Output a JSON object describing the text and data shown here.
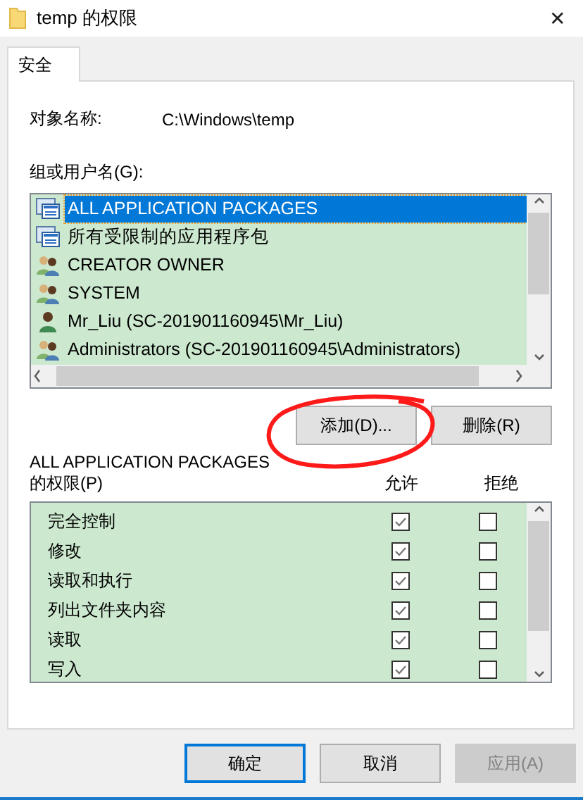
{
  "window": {
    "title": "temp 的权限",
    "close": "✕"
  },
  "tabs": [
    {
      "label": "安全",
      "selected": true
    }
  ],
  "object_name": {
    "label": "对象名称:",
    "value": "C:\\Windows\\temp"
  },
  "groups": {
    "label": "组或用户名(G):",
    "items": [
      {
        "name": "ALL APPLICATION PACKAGES",
        "kind": "package",
        "selected": true
      },
      {
        "name": "所有受限制的应用程序包",
        "kind": "package",
        "selected": false
      },
      {
        "name": "CREATOR OWNER",
        "kind": "group",
        "selected": false
      },
      {
        "name": "SYSTEM",
        "kind": "group",
        "selected": false
      },
      {
        "name": "Mr_Liu (SC-201901160945\\Mr_Liu)",
        "kind": "user",
        "selected": false
      },
      {
        "name": "Administrators (SC-201901160945\\Administrators)",
        "kind": "group",
        "selected": false
      }
    ]
  },
  "group_buttons": [
    {
      "label": "添加(D)...",
      "disabled": false
    },
    {
      "label": "删除(R)",
      "disabled": false
    }
  ],
  "permissions": {
    "title": "ALL APPLICATION PACKAGES",
    "label": "的权限(P)",
    "allow_header": "允许",
    "deny_header": "拒绝",
    "rows": [
      {
        "name": "完全控制",
        "allow": true,
        "deny": false
      },
      {
        "name": "修改",
        "allow": true,
        "deny": false
      },
      {
        "name": "读取和执行",
        "allow": true,
        "deny": false
      },
      {
        "name": "列出文件夹内容",
        "allow": true,
        "deny": false
      },
      {
        "name": "读取",
        "allow": true,
        "deny": false
      },
      {
        "name": "写入",
        "allow": true,
        "deny": false
      }
    ]
  },
  "annotations": [
    {
      "kind": "ellipse"
    }
  ],
  "buttons": [
    {
      "label": "确定",
      "default": true,
      "disabled": false
    },
    {
      "label": "取消",
      "default": false,
      "disabled": false
    },
    {
      "label": "应用(A)",
      "default": false,
      "disabled": true
    }
  ]
}
